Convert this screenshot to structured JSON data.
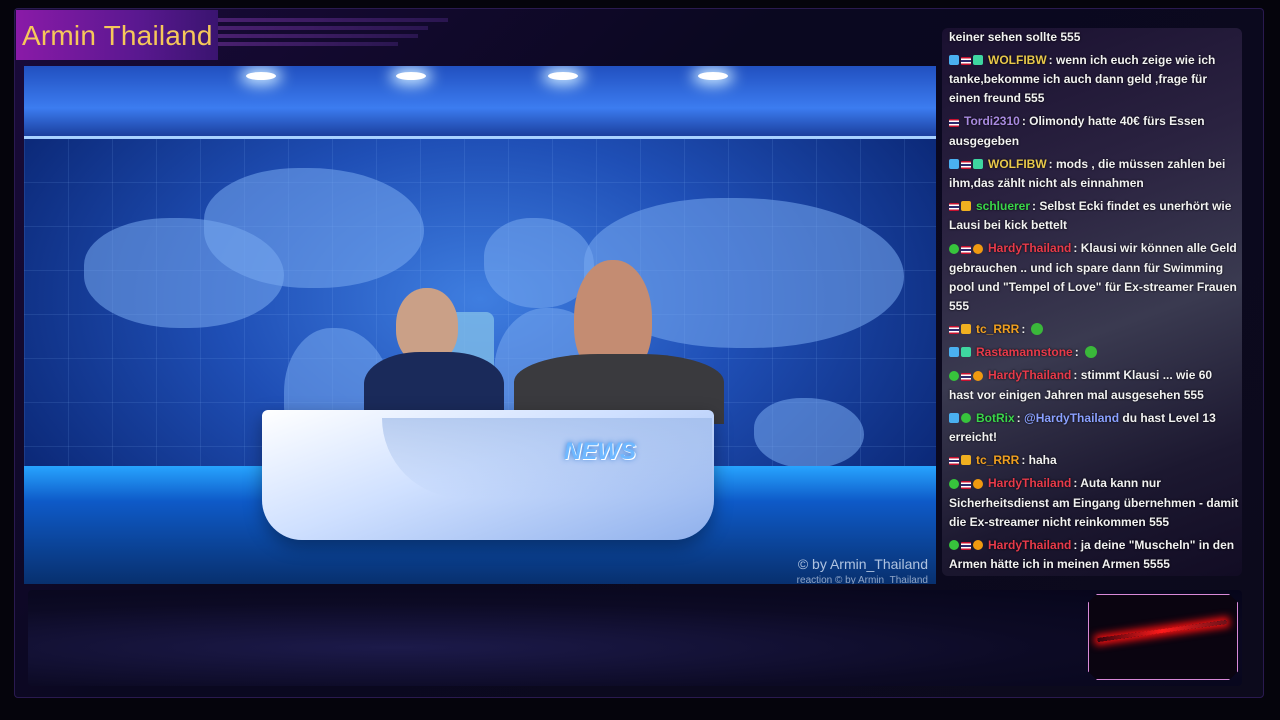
{
  "overlay": {
    "title": "Armin Thailand"
  },
  "video": {
    "desk_label": "NEWS",
    "watermark": "© by Armin_Thailand",
    "watermark_sub": "reaction  © by Armin_Thailand"
  },
  "chat": {
    "messages": [
      {
        "badges": [],
        "user": "",
        "user_color": "#ffffff",
        "text": "keiner sehen sollte 555"
      },
      {
        "badges": [
          "pin-icon",
          "flag-icon",
          "gift-icon"
        ],
        "user": "WOLFIBW",
        "user_color": "#e8c84a",
        "text": ": wenn ich euch zeige wie ich tanke,bekomme ich auch dann geld ,frage für einen freund 555"
      },
      {
        "badges": [
          "flag-icon"
        ],
        "user": "Tordi2310",
        "user_color": "#a98ae0",
        "text": ": Olimondy hatte 40€ fürs Essen ausgegeben"
      },
      {
        "badges": [
          "pin-icon",
          "flag-icon",
          "gift-icon"
        ],
        "user": "WOLFIBW",
        "user_color": "#e8c84a",
        "text": ": mods , die müssen zahlen bei ihm,das zählt nicht als einnahmen"
      },
      {
        "badges": [
          "flag-icon",
          "crown-icon"
        ],
        "user": "schluerer",
        "user_color": "#3ad64a",
        "text": ": Selbst Ecki findet es unerhört wie Lausi bei kick bettelt"
      },
      {
        "badges": [
          "mod-icon",
          "flag-icon",
          "warn-icon"
        ],
        "user": "HardyThailand",
        "user_color": "#e83a4a",
        "text": ": Klausi wir können alle Geld gebrauchen .. und ich spare dann für Swimming pool und \"Tempel of Love\" für Ex-streamer Frauen 555"
      },
      {
        "badges": [
          "flag-icon",
          "crown-icon"
        ],
        "user": "tc_RRR",
        "user_color": "#f0a020",
        "text": ":",
        "emote": true
      },
      {
        "badges": [
          "pin-icon",
          "gift-icon"
        ],
        "user": "Rastamannstone",
        "user_color": "#e83a4a",
        "text": ":",
        "emote": true
      },
      {
        "badges": [
          "mod-icon",
          "flag-icon",
          "warn-icon"
        ],
        "user": "HardyThailand",
        "user_color": "#e83a4a",
        "text": ": stimmt Klausi ... wie 60 hast vor einigen Jahren mal ausgesehen 555"
      },
      {
        "badges": [
          "pin-icon",
          "mod-icon"
        ],
        "user": "BotRix",
        "user_color": "#3ad64a",
        "text": ": ",
        "mention": "@HardyThailand",
        "mention_color": "#8aa0ff",
        "text_after": " du hast Level 13 erreicht!"
      },
      {
        "badges": [
          "flag-icon",
          "crown-icon"
        ],
        "user": "tc_RRR",
        "user_color": "#f0a020",
        "text": ": haha"
      },
      {
        "badges": [
          "mod-icon",
          "flag-icon",
          "warn-icon"
        ],
        "user": "HardyThailand",
        "user_color": "#e83a4a",
        "text": ": Auta kann nur Sicherheitsdienst am Eingang übernehmen - damit die Ex-streamer nicht reinkommen 555"
      },
      {
        "badges": [
          "mod-icon",
          "flag-icon",
          "warn-icon"
        ],
        "user": "HardyThailand",
        "user_color": "#e83a4a",
        "text": ": ja deine \"Muscheln\" in den Armen hätte ich in meinen Armen 5555"
      }
    ]
  }
}
